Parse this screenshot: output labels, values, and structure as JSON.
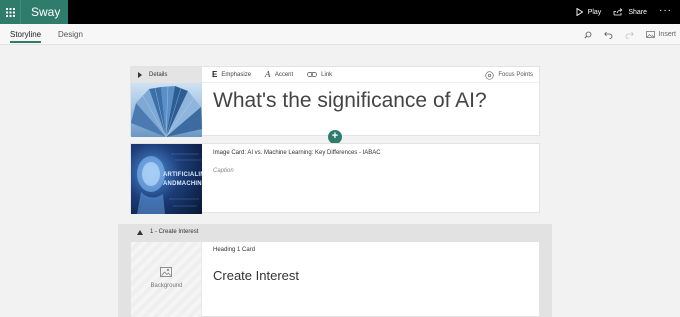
{
  "app": {
    "name": "Sway"
  },
  "topbar": {
    "play_label": "Play",
    "share_label": "Share",
    "more_label": "···"
  },
  "tabs": [
    {
      "label": "Storyline",
      "active": true
    },
    {
      "label": "Design",
      "active": false
    }
  ],
  "toolbar": {
    "insert_label": "Insert"
  },
  "title_card": {
    "details_label": "Details",
    "format_buttons": {
      "emphasize": "Emphasize",
      "accent": "Accent",
      "link": "Link"
    },
    "focus_points_label": "Focus Points",
    "title": "What's the significance of AI?"
  },
  "image_card": {
    "label": "Image Card: AI vs. Machine Learning: Key Differences - IABAC",
    "caption_placeholder": "Caption",
    "image_text_line1": "ARTIFICIALINTE",
    "image_text_line2": "ANDMACHINEL"
  },
  "section": {
    "title": "1 - Create Interest",
    "card_label": "Heading 1 Card",
    "background_label": "Background",
    "heading": "Create Interest"
  },
  "colors": {
    "accent": "#2f7b6c",
    "topbar": "#000000",
    "canvas": "#f2f2f2"
  }
}
